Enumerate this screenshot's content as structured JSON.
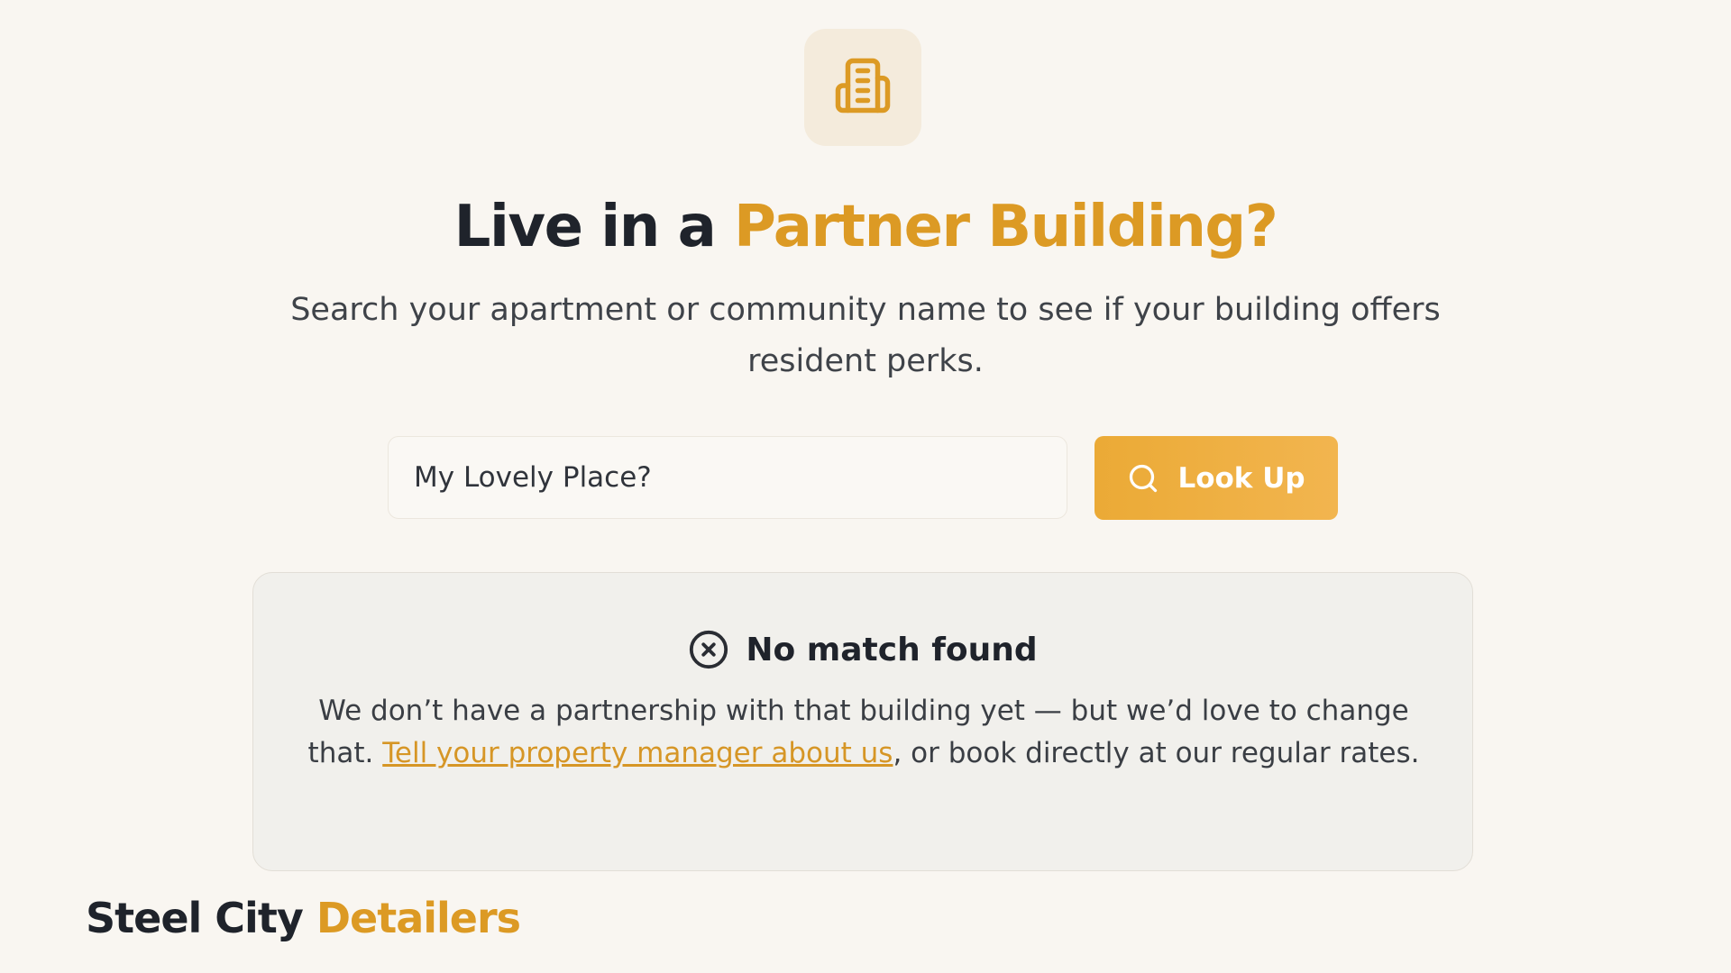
{
  "hero": {
    "icon": "building-icon",
    "title_prefix": "Live in a ",
    "title_accent": "Partner Building?",
    "subtitle": "Search your apartment or community name to see if your building offers resident perks."
  },
  "search": {
    "value": "My Lovely Place?",
    "button_label": "Look Up",
    "button_icon": "search-icon"
  },
  "result": {
    "icon": "x-circle-icon",
    "title": "No match found",
    "body_before_link": "We don’t have a partnership with that building yet — but we’d love to change that. ",
    "link_label": "Tell your property manager about us",
    "body_after_link": ", or book directly at our regular rates."
  },
  "brand": {
    "name_prefix": "Steel City ",
    "name_accent": "Detailers"
  },
  "colors": {
    "accent": "#dc9a24",
    "button": "#efb044",
    "background": "#f9f6f1",
    "card": "#f1f0ec"
  }
}
